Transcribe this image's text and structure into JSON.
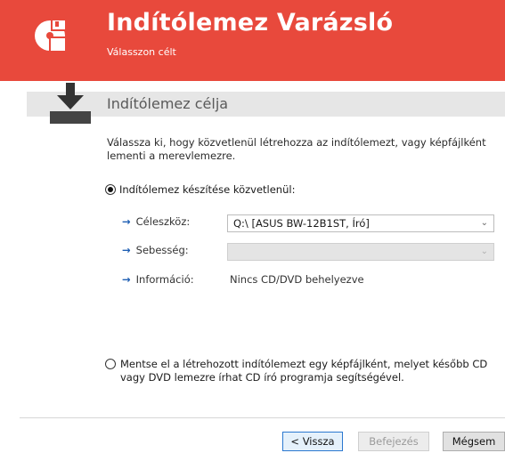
{
  "header": {
    "title": "Indítólemez Varázsló",
    "subtitle": "Válasszon célt",
    "background_color": "#e8493c",
    "icon": "boot-disk-icon"
  },
  "section": {
    "title": "Indítólemez célja",
    "icon": "download-to-drive-icon"
  },
  "description": "Válassza ki, hogy közvetlenül létrehozza az indítólemezt, vagy képfájlként lementi a merevlemezre.",
  "option_direct": {
    "label": "Indítólemez készítése közvetlenül:",
    "selected": true,
    "rows": {
      "target_label": "Céleszköz:",
      "target_value": "Q:\\ [ASUS BW-12B1ST, Író]",
      "speed_label": "Sebesség:",
      "speed_value": "",
      "info_label": "Információ:",
      "info_value": "Nincs CD/DVD behelyezve"
    }
  },
  "option_image": {
    "label": "Mentse el a létrehozott indítólemezt egy képfájlként, melyet később CD vagy DVD lemezre írhat CD író programja segítségével.",
    "selected": false
  },
  "buttons": {
    "back": "< Vissza",
    "finish": "Befejezés",
    "cancel": "Mégsem"
  },
  "colors": {
    "accent_arrow": "#1f5fb4",
    "focus_button_border": "#2b78d0"
  }
}
